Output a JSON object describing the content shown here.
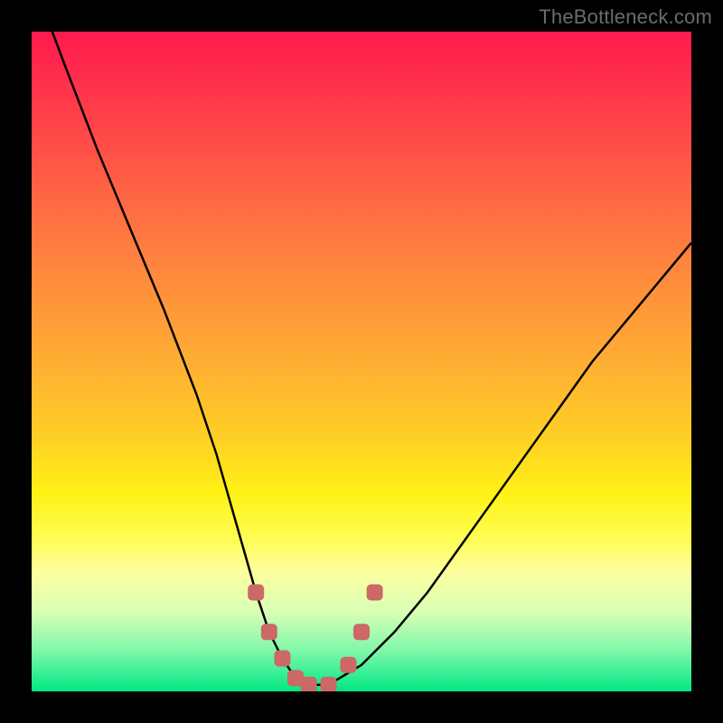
{
  "watermark": "TheBottleneck.com",
  "colors": {
    "frame": "#000000",
    "watermark": "#6b6b6b",
    "gradient_stops": [
      "#ff1a4d",
      "#ff3d4a",
      "#ff6644",
      "#ff8a3d",
      "#ffae33",
      "#ffd124",
      "#fff215",
      "#fffd55",
      "#fdffa0",
      "#d8ffb5",
      "#7cf7a8",
      "#00e885"
    ],
    "curve_stroke": "#000000",
    "marker_fill": "#cc6866"
  },
  "chart_data": {
    "type": "line",
    "title": "",
    "xlabel": "",
    "ylabel": "",
    "xlim": [
      0,
      100
    ],
    "ylim": [
      0,
      100
    ],
    "series": [
      {
        "name": "bottleneck-curve",
        "x": [
          2,
          5,
          10,
          15,
          20,
          25,
          28,
          30,
          32,
          34,
          36,
          38,
          40,
          42,
          45,
          50,
          55,
          60,
          65,
          70,
          75,
          80,
          85,
          90,
          95,
          100
        ],
        "values": [
          103,
          95,
          82,
          70,
          58,
          45,
          36,
          29,
          22,
          15,
          9,
          5,
          2,
          1,
          1,
          4,
          9,
          15,
          22,
          29,
          36,
          43,
          50,
          56,
          62,
          68
        ]
      }
    ],
    "markers": {
      "name": "highlight-markers",
      "x": [
        34,
        36,
        38,
        40,
        42,
        45,
        48,
        50,
        52
      ],
      "values": [
        15,
        9,
        5,
        2,
        1,
        1,
        4,
        9,
        15
      ]
    }
  }
}
